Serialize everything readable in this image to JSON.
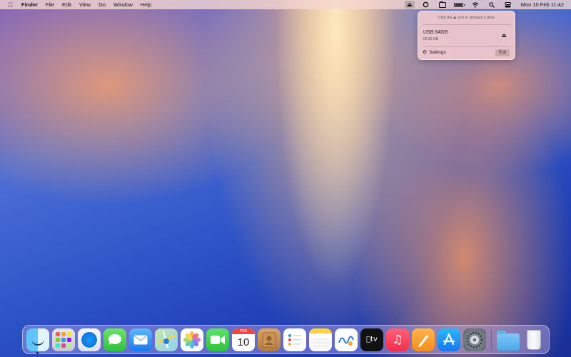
{
  "menubar": {
    "apple_icon": "apple-logo-icon",
    "app_name": "Finder",
    "menus": [
      "File",
      "Edit",
      "View",
      "Go",
      "Window",
      "Help"
    ],
    "status_icons": [
      "eject-icon",
      "sync-icon",
      "display-icon",
      "battery-icon",
      "wifi-icon",
      "search-icon",
      "control-center-icon"
    ],
    "clock": "Mon 10 Feb  11:42"
  },
  "popover": {
    "hint": "Click the ⏏ icon to unmount a drive",
    "drive": {
      "name": "USB 64GB",
      "size": "62,89 GB"
    },
    "settings_label": "Settings",
    "exit_label": "Exit"
  },
  "dock": {
    "apps": [
      "Finder",
      "Launchpad",
      "Safari",
      "Messages",
      "Mail",
      "Maps",
      "Photos",
      "FaceTime",
      "Calendar",
      "Contacts",
      "Reminders",
      "Notes",
      "Freeform",
      "TV",
      "Music",
      "Pages",
      "App Store",
      "System Settings"
    ],
    "calendar": {
      "month": "FEB",
      "day": "10"
    },
    "tv_label": "tv",
    "extras": [
      "Downloads",
      "Trash"
    ]
  }
}
